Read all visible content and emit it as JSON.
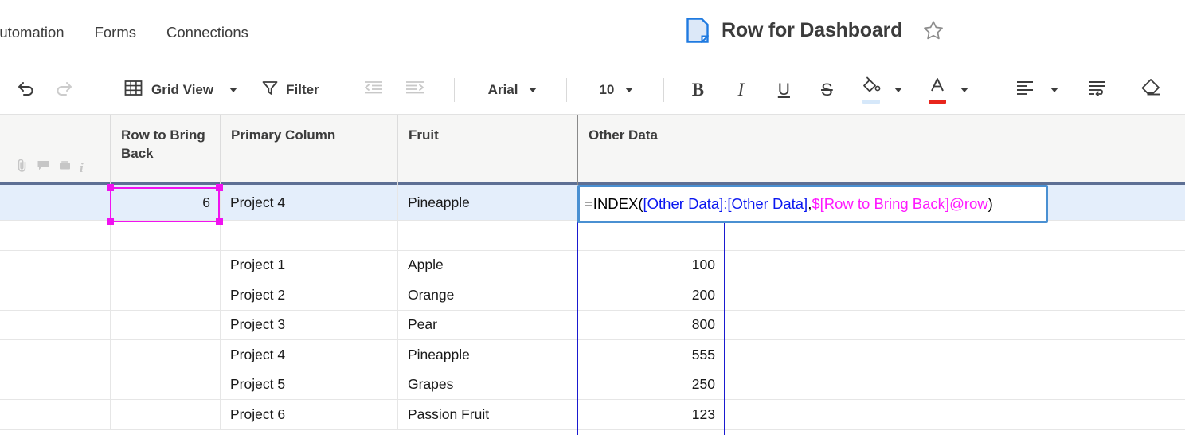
{
  "menu": {
    "items": [
      {
        "label": "Automation",
        "name": "menu-automation"
      },
      {
        "label": "Forms",
        "name": "menu-forms"
      },
      {
        "label": "Connections",
        "name": "menu-connections"
      }
    ]
  },
  "header": {
    "title": "Row for Dashboard",
    "sheet_icon": "sheet-icon",
    "favorite_icon": "star-icon"
  },
  "toolbar": {
    "undo_icon": "undo-icon",
    "redo_icon": "redo-icon",
    "view_label": "Grid View",
    "view_icon": "grid-icon",
    "filter_label": "Filter",
    "filter_icon": "funnel-icon",
    "outdent_icon": "outdent-icon",
    "indent_icon": "indent-icon",
    "font_family": "Arial",
    "font_size": "10",
    "bold_label": "B",
    "italic_label": "I",
    "underline_label": "U",
    "strikethrough_label": "S",
    "fill_color": "#d6e8fa",
    "text_color": "#e8251c",
    "align_icon": "align-left-icon",
    "wrap_icon": "wrap-text-icon",
    "clear_format_icon": "eraser-icon"
  },
  "grid": {
    "gutter_icons": [
      "attachment-icon",
      "comment-icon",
      "proof-icon",
      "info-icon"
    ],
    "columns": [
      {
        "label": "Row to Bring Back"
      },
      {
        "label": "Primary Column"
      },
      {
        "label": "Fruit"
      },
      {
        "label": "Other Data"
      }
    ],
    "rows": [
      {
        "row_to_bring_back": "6",
        "primary_column": "Project 4",
        "fruit": "Pineapple",
        "other_data": "",
        "highlighted": true
      },
      {
        "row_to_bring_back": "",
        "primary_column": "",
        "fruit": "",
        "other_data": "",
        "highlighted": false
      },
      {
        "row_to_bring_back": "",
        "primary_column": "Project 1",
        "fruit": "Apple",
        "other_data": "100",
        "highlighted": false
      },
      {
        "row_to_bring_back": "",
        "primary_column": "Project 2",
        "fruit": "Orange",
        "other_data": "200",
        "highlighted": false
      },
      {
        "row_to_bring_back": "",
        "primary_column": "Project 3",
        "fruit": "Pear",
        "other_data": "800",
        "highlighted": false
      },
      {
        "row_to_bring_back": "",
        "primary_column": "Project 4",
        "fruit": "Pineapple",
        "other_data": "555",
        "highlighted": false
      },
      {
        "row_to_bring_back": "",
        "primary_column": "Project 5",
        "fruit": "Grapes",
        "other_data": "250",
        "highlighted": false
      },
      {
        "row_to_bring_back": "",
        "primary_column": "Project 6",
        "fruit": "Passion Fruit",
        "other_data": "123",
        "highlighted": false
      }
    ]
  },
  "editor": {
    "full_formula": "=INDEX([Other Data]:[Other Data], $[Row to Bring Back]@row)",
    "tokens": {
      "t1": "=INDEX(",
      "t2": "[Other Data]:[Other Data]",
      "t3": ", ",
      "t4": "$[Row to Bring Back]@row",
      "t5": ")"
    },
    "range_highlight_color": "#1a1ad0",
    "param_highlight_color": "#ff19ff",
    "border_color": "#4a90d2"
  },
  "selection": {
    "cell_value": "6",
    "border_color": "#f012f0"
  }
}
